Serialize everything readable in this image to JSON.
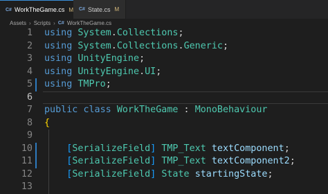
{
  "tabs": [
    {
      "icon": "C#",
      "label": "WorkTheGame.cs",
      "badge": "M",
      "close": "×"
    },
    {
      "icon": "C#",
      "label": "State.cs",
      "badge": "M"
    }
  ],
  "breadcrumb": {
    "items": [
      "Assets",
      "Scripts",
      "WorkTheGame.cs"
    ],
    "file_icon": "C#",
    "separator": "›"
  },
  "lines": [
    {
      "num": "1",
      "tokens": [
        [
          "kw",
          "using"
        ],
        [
          "plain",
          " "
        ],
        [
          "ns",
          "System"
        ],
        [
          "plain",
          "."
        ],
        [
          "ns",
          "Collections"
        ],
        [
          "plain",
          ";"
        ]
      ]
    },
    {
      "num": "2",
      "tokens": [
        [
          "kw",
          "using"
        ],
        [
          "plain",
          " "
        ],
        [
          "ns",
          "System"
        ],
        [
          "plain",
          "."
        ],
        [
          "ns",
          "Collections"
        ],
        [
          "plain",
          "."
        ],
        [
          "ns",
          "Generic"
        ],
        [
          "plain",
          ";"
        ]
      ]
    },
    {
      "num": "3",
      "tokens": [
        [
          "kw",
          "using"
        ],
        [
          "plain",
          " "
        ],
        [
          "ns",
          "UnityEngine"
        ],
        [
          "plain",
          ";"
        ]
      ]
    },
    {
      "num": "4",
      "tokens": [
        [
          "kw",
          "using"
        ],
        [
          "plain",
          " "
        ],
        [
          "ns",
          "UnityEngine"
        ],
        [
          "plain",
          "."
        ],
        [
          "ns",
          "UI"
        ],
        [
          "plain",
          ";"
        ]
      ]
    },
    {
      "num": "5",
      "tokens": [
        [
          "kw",
          "using"
        ],
        [
          "plain",
          " "
        ],
        [
          "ns",
          "TMPro"
        ],
        [
          "plain",
          ";"
        ]
      ]
    },
    {
      "num": "6",
      "tokens": []
    },
    {
      "num": "7",
      "tokens": [
        [
          "kw",
          "public"
        ],
        [
          "plain",
          " "
        ],
        [
          "kw",
          "class"
        ],
        [
          "plain",
          " "
        ],
        [
          "cls",
          "WorkTheGame"
        ],
        [
          "plain",
          " : "
        ],
        [
          "cls",
          "MonoBehaviour"
        ]
      ]
    },
    {
      "num": "8",
      "tokens": [
        [
          "brace",
          "{"
        ]
      ]
    },
    {
      "num": "9",
      "tokens": []
    },
    {
      "num": "10",
      "tokens": [
        [
          "plain",
          "    "
        ],
        [
          "bracket",
          "["
        ],
        [
          "attr",
          "SerializeField"
        ],
        [
          "bracket",
          "]"
        ],
        [
          "plain",
          " "
        ],
        [
          "type",
          "TMP_Text"
        ],
        [
          "plain",
          " "
        ],
        [
          "ident",
          "textComponent"
        ],
        [
          "plain",
          ";"
        ]
      ]
    },
    {
      "num": "11",
      "tokens": [
        [
          "plain",
          "    "
        ],
        [
          "bracket",
          "["
        ],
        [
          "attr",
          "SerializeField"
        ],
        [
          "bracket",
          "]"
        ],
        [
          "plain",
          " "
        ],
        [
          "type",
          "TMP_Text"
        ],
        [
          "plain",
          " "
        ],
        [
          "ident",
          "textComponent2"
        ],
        [
          "plain",
          ";"
        ]
      ]
    },
    {
      "num": "12",
      "tokens": [
        [
          "plain",
          "    "
        ],
        [
          "bracket",
          "["
        ],
        [
          "attr",
          "SerializeField"
        ],
        [
          "bracket",
          "]"
        ],
        [
          "plain",
          " "
        ],
        [
          "type",
          "State"
        ],
        [
          "plain",
          " "
        ],
        [
          "ident",
          "startingState"
        ],
        [
          "plain",
          ";"
        ]
      ]
    },
    {
      "num": "13",
      "tokens": []
    }
  ],
  "current_line": "6",
  "modified_lines": [
    "5",
    "10",
    "11"
  ],
  "colors": {
    "background": "#1e1e1e",
    "keyword": "#569cd6",
    "type": "#4ec9b0",
    "identifier": "#9cdcfe",
    "brace": "#ffd700",
    "bracket": "#179fff",
    "modified_badge": "#d7ba7d",
    "gutter_modified": "#2e7bbf"
  }
}
